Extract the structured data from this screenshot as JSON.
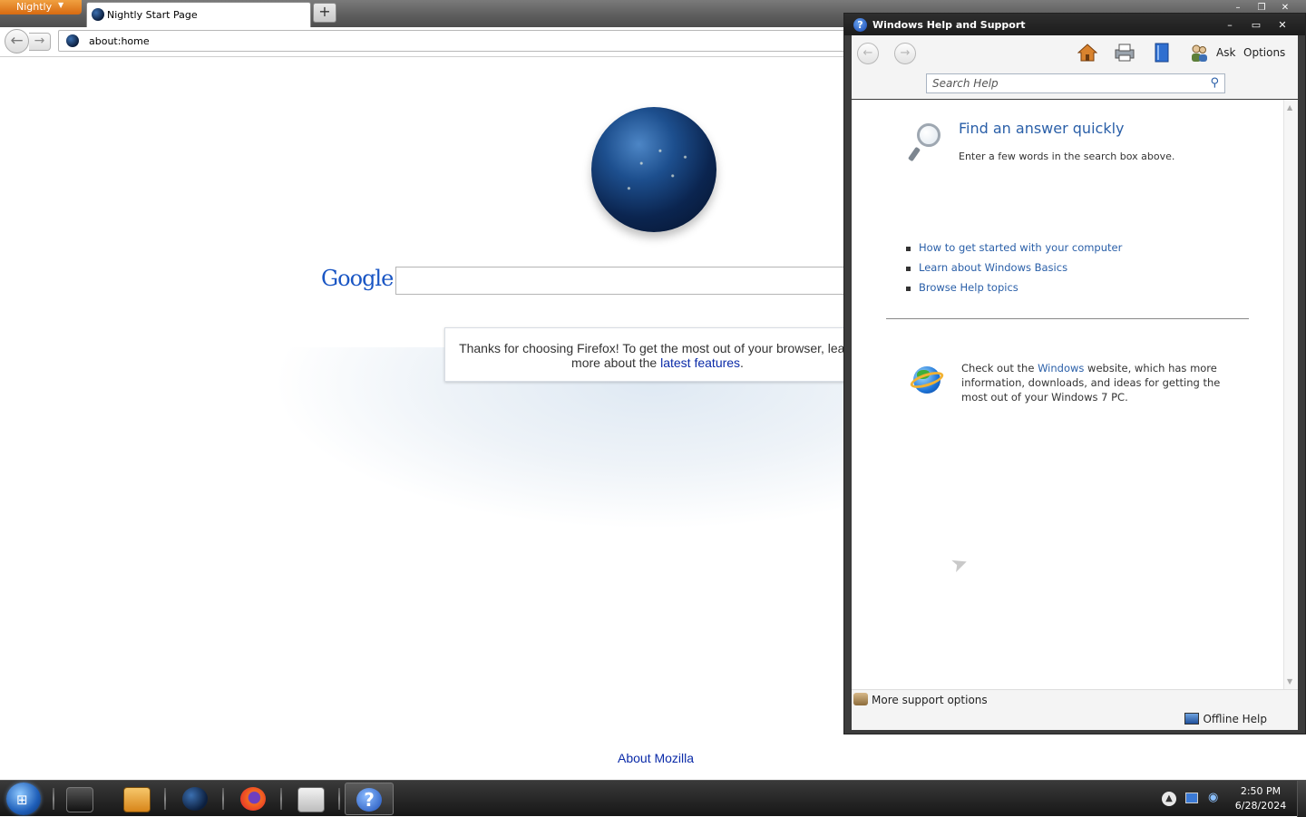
{
  "browser": {
    "app_menu_label": "Nightly",
    "tab_title": "Nightly Start Page",
    "new_tab_symbol": "+",
    "url": "about:home",
    "back_symbol": "←",
    "forward_symbol": "→"
  },
  "start_page": {
    "search_logo": "Google",
    "snippet_text": "Thanks for choosing Firefox! To get the most out of your browser, learn more about the ",
    "snippet_link": "latest features",
    "snippet_end": ".",
    "footer_link": "About Mozilla"
  },
  "help_window": {
    "title": "Windows Help and Support",
    "caption_buttons": {
      "minimize": "–",
      "maximize": "▭",
      "close": "✕"
    },
    "toolbar": {
      "back_symbol": "←",
      "forward_symbol": "→",
      "icons": [
        "home-icon",
        "print-icon",
        "browse-help-icon",
        "ask-icon"
      ],
      "ask_label": "Ask",
      "options_label": "Options"
    },
    "search_placeholder": "Search Help",
    "find_title": "Find an answer quickly",
    "find_subtitle": "Enter a few words in the search box above.",
    "links": [
      "How to get started with your computer",
      "Learn about Windows Basics",
      "Browse Help topics"
    ],
    "check_text_before": "Check out the ",
    "check_link": "Windows",
    "check_text_after": " website, which has more information, downloads, and ideas for getting the most out of your Windows 7 PC.",
    "more_support": "More support options",
    "offline_help": "Offline Help"
  },
  "taskbar": {
    "apps": [
      "explorer-icon",
      "media-player-icon",
      "nightly-icon",
      "firefox-icon",
      "notepad-icon",
      "help-icon"
    ],
    "clock_time": "2:50 PM",
    "clock_date": "6/28/2024"
  },
  "colors": {
    "link_blue": "#2a5fa8",
    "nightly_orange": "#e07d1c",
    "titlebar_dark": "#1c1c1c"
  }
}
